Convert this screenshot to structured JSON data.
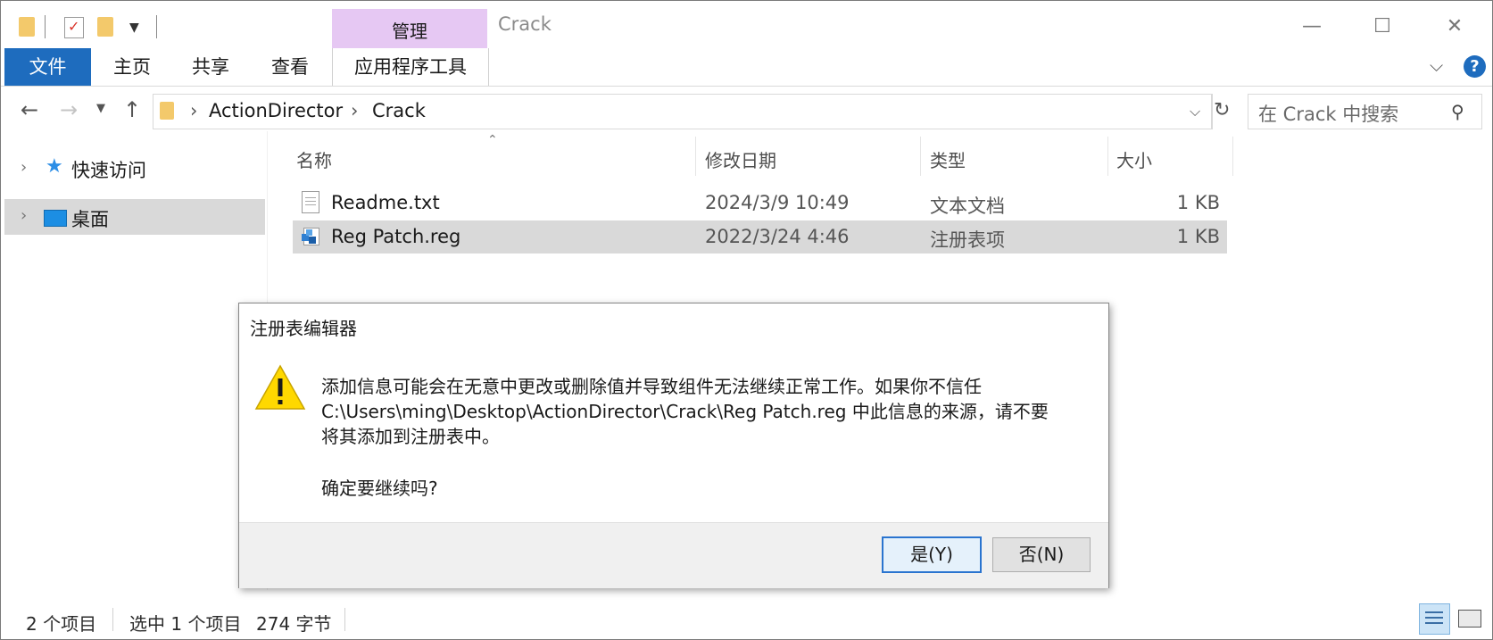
{
  "window": {
    "title": "Crack",
    "context_tab_group": "管理"
  },
  "ribbon": {
    "tabs": [
      {
        "label": "文件"
      },
      {
        "label": "主页"
      },
      {
        "label": "共享"
      },
      {
        "label": "查看"
      },
      {
        "label": "应用程序工具"
      }
    ]
  },
  "address": {
    "crumbs": [
      "ActionDirector",
      "Crack"
    ],
    "search_placeholder": "在 Crack 中搜索"
  },
  "nav_pane": {
    "items": [
      {
        "label": "快速访问",
        "icon": "star-icon"
      },
      {
        "label": "桌面",
        "icon": "desktop-icon"
      }
    ]
  },
  "file_list": {
    "columns": [
      "名称",
      "修改日期",
      "类型",
      "大小"
    ],
    "rows": [
      {
        "name": "Readme.txt",
        "modified": "2024/3/9 10:49",
        "type": "文本文档",
        "size": "1 KB",
        "icon": "text-file-icon"
      },
      {
        "name": "Reg Patch.reg",
        "modified": "2022/3/24 4:46",
        "type": "注册表项",
        "size": "1 KB",
        "icon": "registry-file-icon"
      }
    ]
  },
  "dialog": {
    "title": "注册表编辑器",
    "message_line1": "添加信息可能会在无意中更改或删除值并导致组件无法继续正常工作。如果你不信任",
    "message_line2": "C:\\Users\\ming\\Desktop\\ActionDirector\\Crack\\Reg Patch.reg 中此信息的来源，请不要",
    "message_line3": "将其添加到注册表中。",
    "question": "确定要继续吗?",
    "yes_label": "是(Y)",
    "no_label": "否(N)"
  },
  "status_bar": {
    "item_count": "2 个项目",
    "selection": "选中 1 个项目",
    "selection_size": "274 字节"
  },
  "colors": {
    "accent": "#1e6cbe",
    "context_tab": "#e6c8f3",
    "selected_row": "#d9d9d9",
    "warning_yellow": "#ffd800"
  }
}
